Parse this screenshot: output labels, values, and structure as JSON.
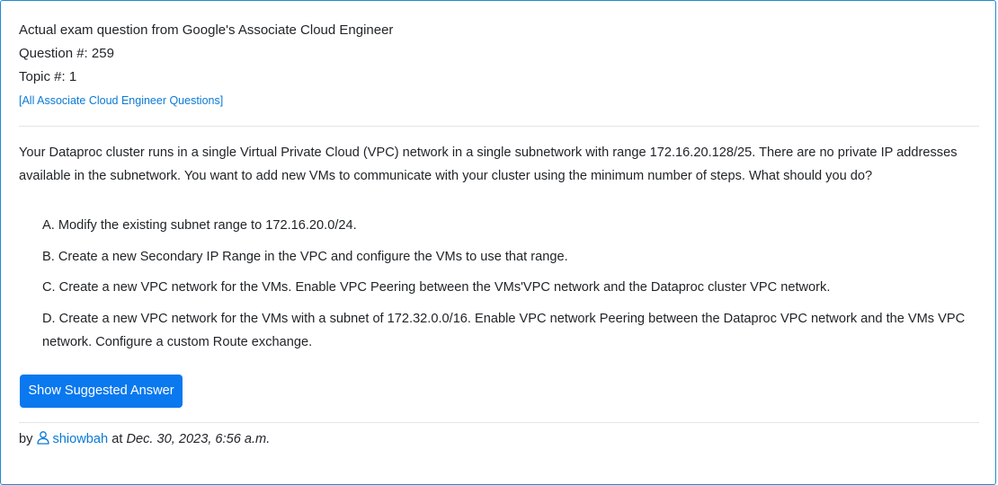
{
  "header": {
    "exam_line": "Actual exam question from Google's Associate Cloud Engineer",
    "question_number": "Question #: 259",
    "topic_number": "Topic #: 1",
    "all_questions_link": "[All Associate Cloud Engineer Questions]"
  },
  "question": {
    "text": "Your Dataproc cluster runs in a single Virtual Private Cloud (VPC) network in a single subnetwork with range 172.16.20.128/25. There are no private IP addresses available in the subnetwork. You want to add new VMs to communicate with your cluster using the minimum number of steps. What should you do?"
  },
  "choices": [
    "A. Modify the existing subnet range to 172.16.20.0/24.",
    "B. Create a new Secondary IP Range in the VPC and configure the VMs to use that range.",
    "C. Create a new VPC network for the VMs. Enable VPC Peering between the VMs'VPC network and the Dataproc cluster VPC network.",
    "D. Create a new VPC network for the VMs with a subnet of 172.32.0.0/16. Enable VPC network Peering between the Dataproc VPC network and the VMs VPC network. Configure a custom Route exchange."
  ],
  "actions": {
    "show_answer_label": "Show Suggested Answer"
  },
  "byline": {
    "prefix": "by",
    "user_icon": "user-outline-icon",
    "username": "shiowbah",
    "at": "at",
    "date": "Dec. 30, 2023, 6:56 a.m."
  },
  "colors": {
    "accent": "#0a78ef",
    "link": "#0a7ad6",
    "border": "#1f8bd3",
    "text": "#212529"
  }
}
